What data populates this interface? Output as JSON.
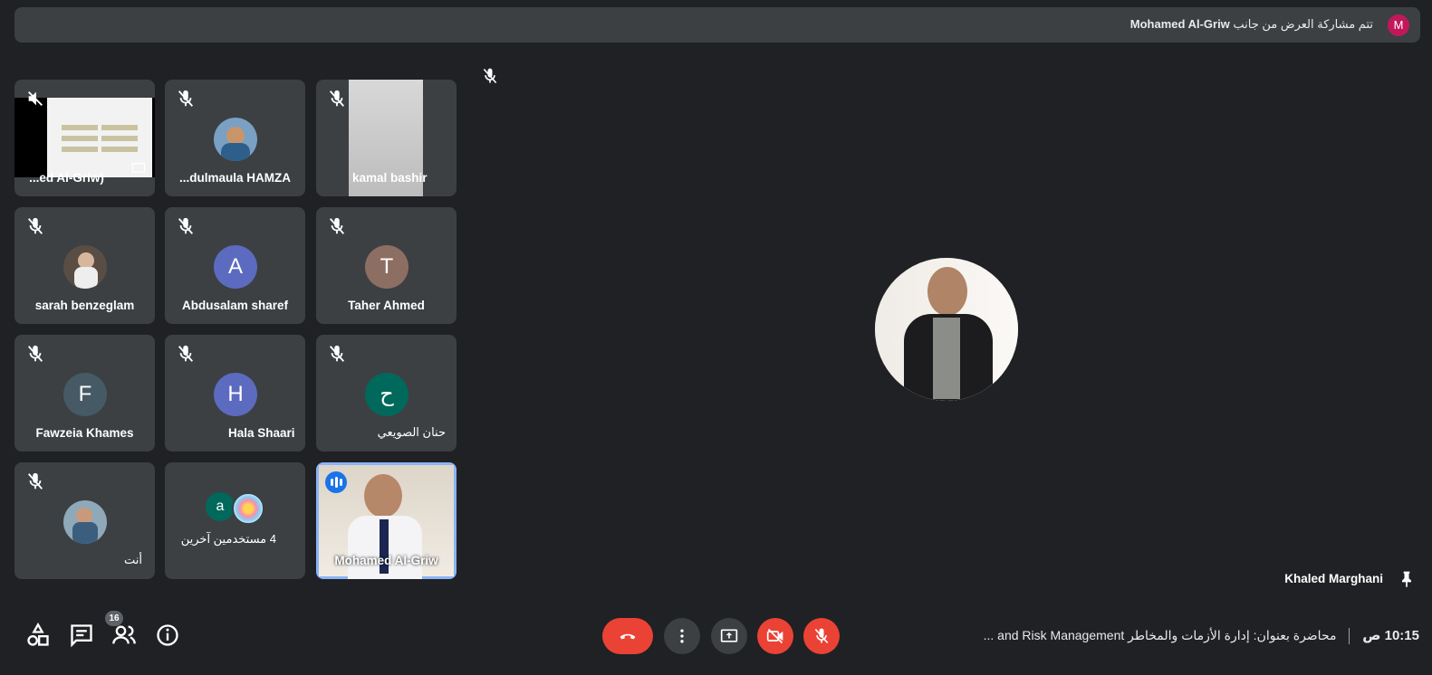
{
  "banner": {
    "presenter": "Mohamed Al-Griw",
    "text": "تتم مشاركة العرض من جانب",
    "avatar_letter": "M"
  },
  "tiles": [
    {
      "name": "...ed Al-Griw)"
    },
    {
      "name": "...dulmaula HAMZA"
    },
    {
      "name": "kamal bashir"
    },
    {
      "name": "sarah benzeglam"
    },
    {
      "name": "Abdusalam sharef",
      "letter": "A"
    },
    {
      "name": "Taher Ahmed",
      "letter": "T"
    },
    {
      "name": "Fawzeia Khames",
      "letter": "F"
    },
    {
      "name": "Hala Shaari",
      "letter": "H"
    },
    {
      "name": "حنان الصويعي",
      "letter": "ح"
    },
    {
      "name": "أنت"
    },
    {
      "name": "4 مستخدمين آخرين",
      "letter": "a"
    },
    {
      "name": "Mohamed Al-Griw"
    }
  ],
  "main_speaker": {
    "name": "Khaled Marghani"
  },
  "participants_count": "16",
  "meeting": {
    "time": "10:15 ص",
    "title": "محاضرة بعنوان: إدارة الأزمات والمخاطر and Risk Management ..."
  },
  "colors": {
    "background": "#202124",
    "tile": "#3c4043",
    "accent": "#8ab4f8",
    "red": "#ea4335"
  }
}
